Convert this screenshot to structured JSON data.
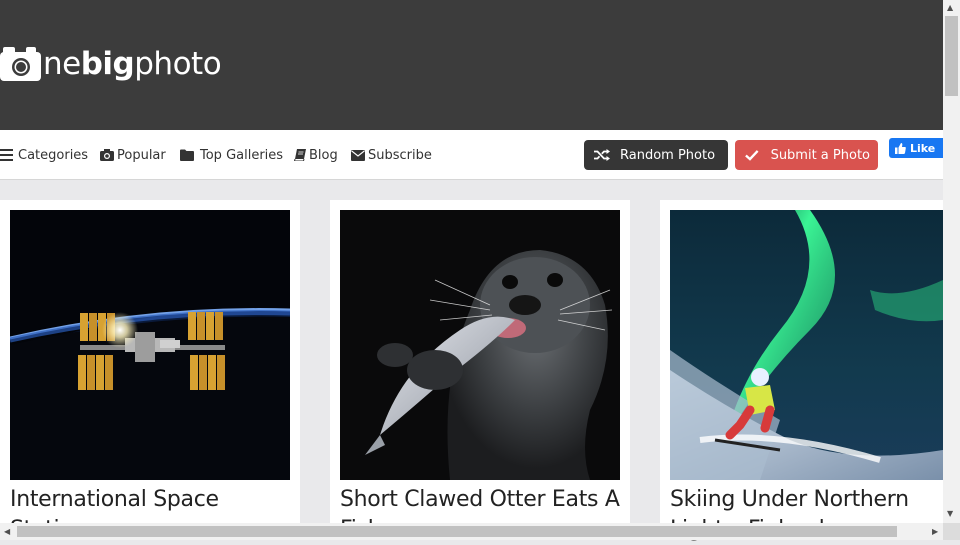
{
  "brand": {
    "logo_part1": "ne",
    "logo_part2": "big",
    "logo_part3": "photo",
    "logo_icon": "camera-icon"
  },
  "nav": {
    "items": [
      {
        "label": "Categories",
        "icon": "bars-icon"
      },
      {
        "label": "Popular",
        "icon": "camera-icon"
      },
      {
        "label": "Top Galleries",
        "icon": "folder-icon"
      },
      {
        "label": "Blog",
        "icon": "book-icon"
      },
      {
        "label": "Subscribe",
        "icon": "envelope-icon"
      }
    ],
    "random_button": "Random Photo",
    "submit_button": "Submit a Photo",
    "fb_like": "Like"
  },
  "cards": [
    {
      "title": "International Space Station"
    },
    {
      "title": "Short Clawed Otter Eats A Fish"
    },
    {
      "title": "Skiing Under Northern Lights, Finland"
    }
  ],
  "colors": {
    "header_bg": "#3c3c3c",
    "submit_red": "#d9534f",
    "random_dark": "#363636",
    "facebook_blue": "#1877f2"
  }
}
